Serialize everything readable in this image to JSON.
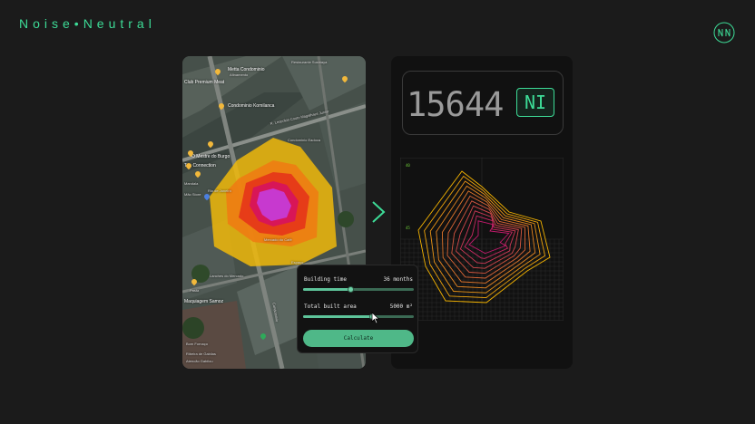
{
  "header": {
    "brand": "Noise•Neutral",
    "logo_icon": "nn-logo-icon"
  },
  "map": {
    "labels": [
      "Metta Condominio",
      "Afinamento",
      "Club Premium Meat",
      "Condominio Komilanca",
      "R. Leopoldo Couto Magalhaes Junior",
      "Condominio Eadoca",
      "O Mestre do Burgo",
      "Tea Connection",
      "Mandala",
      "Mão Store",
      "Rio de Janeiro",
      "Mercado do Café",
      "Espaço",
      "Lanches do Mercado",
      "Pasta",
      "Maquiagem Samoz",
      "Restaurante",
      "Bom Fornaço",
      "Ribeira de Gabilas",
      "Atencão Gabilou",
      "Restaurante Sushiaya",
      "Condominio"
    ]
  },
  "arrow_icon": "chevron-right-icon",
  "result": {
    "score": "15644",
    "unit": "NI",
    "axis_ticks": [
      "40",
      "45"
    ]
  },
  "controls": {
    "building_time_label": "Building time",
    "building_time_value": "36 months",
    "building_time_level": 0.43,
    "built_area_label": "Total built area",
    "built_area_value": "5000 m²",
    "built_area_level": 0.63,
    "calculate_label": "Calculate"
  },
  "colors": {
    "accent": "#3ddc97",
    "button": "#4fb888",
    "contour_outer": "#f5b400",
    "contour_inner": "#c41a6d"
  }
}
